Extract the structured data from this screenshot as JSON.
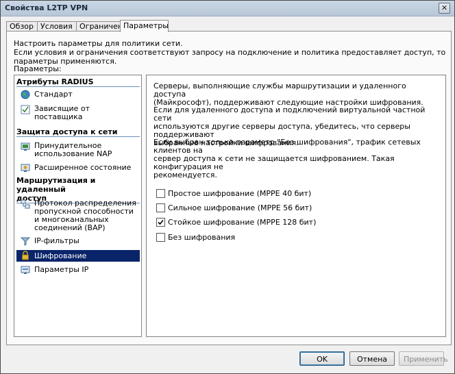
{
  "window": {
    "title": "Свойства L2TP VPN",
    "close_glyph": "✕"
  },
  "tabs": [
    {
      "label": "Обзор"
    },
    {
      "label": "Условия"
    },
    {
      "label": "Ограничения"
    },
    {
      "label": "Параметры"
    }
  ],
  "intro": {
    "line1": "Настроить параметры для политики сети.",
    "line2": "Если условия и ограничения соответствуют запросу на подключение и политика предоставляет доступ, то параметры применяются."
  },
  "params_label": "Параметры:",
  "sidebar": {
    "groups": [
      {
        "header": "Атрибуты RADIUS"
      },
      {
        "header": "Защита доступа к сети"
      },
      {
        "header_line1": "Маршрутизация и удаленный",
        "header_line2": "доступ"
      }
    ],
    "items": [
      {
        "line1": "Стандарт",
        "icon": "globe-icon"
      },
      {
        "line1": "Зависящие от",
        "line2": "поставщика",
        "icon": "checklist-icon"
      },
      {
        "line1": "Принудительное",
        "line2": "использование NAP",
        "icon": "nap-icon"
      },
      {
        "line1": "Расширенное состояние",
        "icon": "status-icon"
      },
      {
        "line1": "Протокол распределения",
        "line2": "пропускной способности",
        "line3": "и многоканальных",
        "line4": "соединений (BAP)",
        "icon": "network-icon"
      },
      {
        "line1": "IP-фильтры",
        "icon": "filter-icon"
      },
      {
        "line1": "Шифрование",
        "icon": "lock-icon",
        "selected": true
      },
      {
        "line1": "Параметры IP",
        "icon": "ip-settings-icon"
      }
    ]
  },
  "main": {
    "para1_line1": "Серверы, выполняющие службы маршрутизации и удаленного доступа",
    "para1_line2": "(Майкрософт), поддерживают следующие настройки шифрования.",
    "para2_line1": "Если для удаленного доступа и подключений виртуальной частной сети",
    "para2_line2": "используются другие серверы доступа, убедитесь, что серверы поддерживают",
    "para2_line3": "выбранные настройки шифрования.",
    "para3_line1": "Если выбран только параметр \"Без шифрования\", трафик сетевых клиентов на",
    "para3_line2": "сервер доступа к сети не защищается шифрованием. Такая конфигурация не",
    "para3_line3": "рекомендуется.",
    "options": [
      {
        "label": "Простое шифрование (MPPE 40 бит)",
        "checked": false
      },
      {
        "label": "Сильное шифрование (MPPE 56 бит)",
        "checked": false
      },
      {
        "label": "Стойкое шифрование (MPPE 128 бит)",
        "checked": true
      },
      {
        "label": "Без шифрования",
        "checked": false
      }
    ]
  },
  "buttons": {
    "ok": "OK",
    "cancel": "Отмена",
    "apply": "Применить"
  },
  "colors": {
    "selection": "#0a246a",
    "group_underline": "#6b8fb8"
  }
}
